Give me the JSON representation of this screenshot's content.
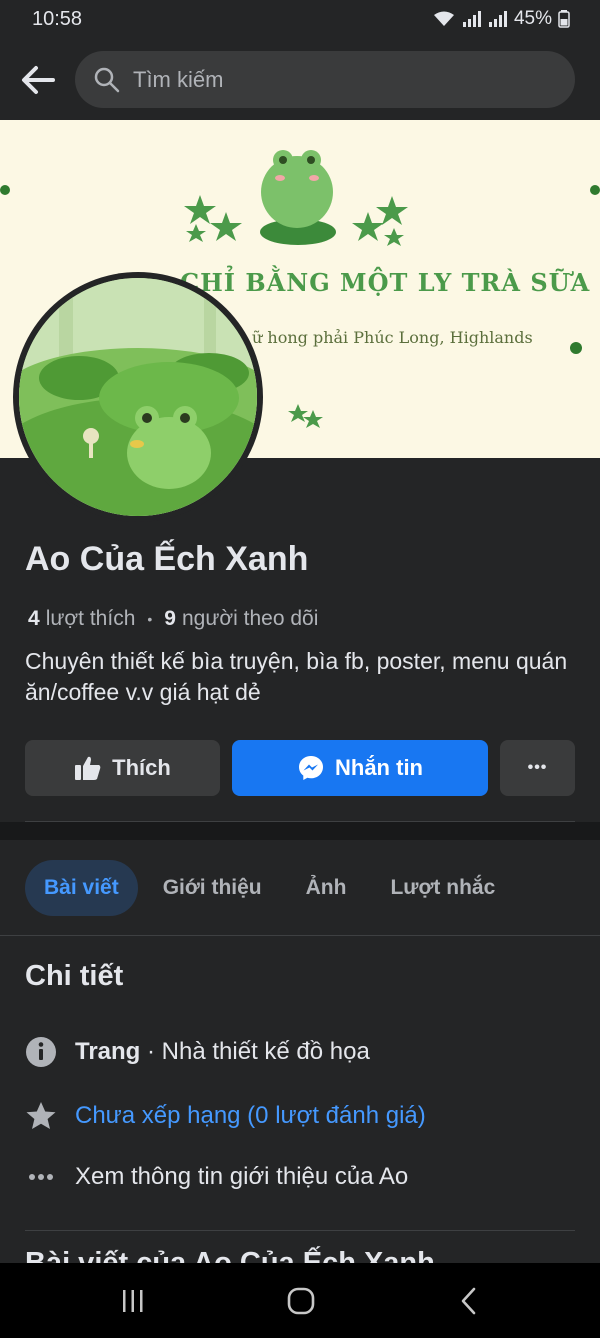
{
  "status": {
    "time": "10:58",
    "battery": "45%"
  },
  "search": {
    "placeholder": "Tìm kiếm"
  },
  "cover": {
    "line1": "CHỈ BẰNG MỘT LY TRÀ SỮA",
    "line2": "ữ hong phải Phúc Long, Highlands"
  },
  "page": {
    "name": "Ao Của Ếch Xanh",
    "likes_count": "4",
    "likes_label": "lượt thích",
    "separator": "•",
    "followers_count": "9",
    "followers_label": "người theo dõi",
    "bio": "Chuyên thiết kế bìa truyện, bìa fb, poster, menu quán ăn/coffee v.v giá hạt dẻ"
  },
  "actions": {
    "like": "Thích",
    "message": "Nhắn tin",
    "more": "•••"
  },
  "tabs": [
    {
      "label": "Bài viết",
      "active": true
    },
    {
      "label": "Giới thiệu",
      "active": false
    },
    {
      "label": "Ảnh",
      "active": false
    },
    {
      "label": "Lượt nhắc",
      "active": false
    }
  ],
  "details": {
    "title": "Chi tiết",
    "category_label": "Trang",
    "category_value": " · Nhà thiết kế đồ họa",
    "rating": "Chưa xếp hạng (0 lượt đánh giá)",
    "see_more": "Xem thông tin giới thiệu của Ao"
  },
  "posts": {
    "title": "Bài viết của Ao Của Ếch Xanh"
  },
  "colors": {
    "accent": "#1877f2",
    "link": "#4599ff",
    "background": "#242526"
  }
}
